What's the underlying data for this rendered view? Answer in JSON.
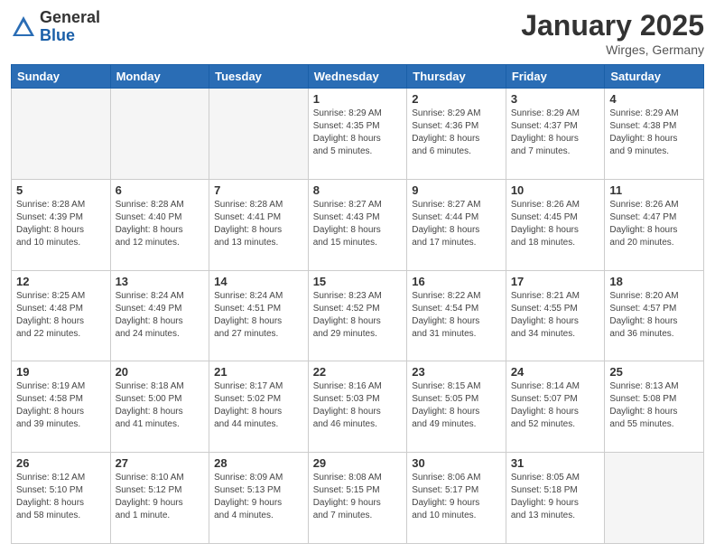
{
  "logo": {
    "general": "General",
    "blue": "Blue"
  },
  "header": {
    "month": "January 2025",
    "location": "Wirges, Germany"
  },
  "weekdays": [
    "Sunday",
    "Monday",
    "Tuesday",
    "Wednesday",
    "Thursday",
    "Friday",
    "Saturday"
  ],
  "weeks": [
    [
      {
        "day": "",
        "info": ""
      },
      {
        "day": "",
        "info": ""
      },
      {
        "day": "",
        "info": ""
      },
      {
        "day": "1",
        "info": "Sunrise: 8:29 AM\nSunset: 4:35 PM\nDaylight: 8 hours\nand 5 minutes."
      },
      {
        "day": "2",
        "info": "Sunrise: 8:29 AM\nSunset: 4:36 PM\nDaylight: 8 hours\nand 6 minutes."
      },
      {
        "day": "3",
        "info": "Sunrise: 8:29 AM\nSunset: 4:37 PM\nDaylight: 8 hours\nand 7 minutes."
      },
      {
        "day": "4",
        "info": "Sunrise: 8:29 AM\nSunset: 4:38 PM\nDaylight: 8 hours\nand 9 minutes."
      }
    ],
    [
      {
        "day": "5",
        "info": "Sunrise: 8:28 AM\nSunset: 4:39 PM\nDaylight: 8 hours\nand 10 minutes."
      },
      {
        "day": "6",
        "info": "Sunrise: 8:28 AM\nSunset: 4:40 PM\nDaylight: 8 hours\nand 12 minutes."
      },
      {
        "day": "7",
        "info": "Sunrise: 8:28 AM\nSunset: 4:41 PM\nDaylight: 8 hours\nand 13 minutes."
      },
      {
        "day": "8",
        "info": "Sunrise: 8:27 AM\nSunset: 4:43 PM\nDaylight: 8 hours\nand 15 minutes."
      },
      {
        "day": "9",
        "info": "Sunrise: 8:27 AM\nSunset: 4:44 PM\nDaylight: 8 hours\nand 17 minutes."
      },
      {
        "day": "10",
        "info": "Sunrise: 8:26 AM\nSunset: 4:45 PM\nDaylight: 8 hours\nand 18 minutes."
      },
      {
        "day": "11",
        "info": "Sunrise: 8:26 AM\nSunset: 4:47 PM\nDaylight: 8 hours\nand 20 minutes."
      }
    ],
    [
      {
        "day": "12",
        "info": "Sunrise: 8:25 AM\nSunset: 4:48 PM\nDaylight: 8 hours\nand 22 minutes."
      },
      {
        "day": "13",
        "info": "Sunrise: 8:24 AM\nSunset: 4:49 PM\nDaylight: 8 hours\nand 24 minutes."
      },
      {
        "day": "14",
        "info": "Sunrise: 8:24 AM\nSunset: 4:51 PM\nDaylight: 8 hours\nand 27 minutes."
      },
      {
        "day": "15",
        "info": "Sunrise: 8:23 AM\nSunset: 4:52 PM\nDaylight: 8 hours\nand 29 minutes."
      },
      {
        "day": "16",
        "info": "Sunrise: 8:22 AM\nSunset: 4:54 PM\nDaylight: 8 hours\nand 31 minutes."
      },
      {
        "day": "17",
        "info": "Sunrise: 8:21 AM\nSunset: 4:55 PM\nDaylight: 8 hours\nand 34 minutes."
      },
      {
        "day": "18",
        "info": "Sunrise: 8:20 AM\nSunset: 4:57 PM\nDaylight: 8 hours\nand 36 minutes."
      }
    ],
    [
      {
        "day": "19",
        "info": "Sunrise: 8:19 AM\nSunset: 4:58 PM\nDaylight: 8 hours\nand 39 minutes."
      },
      {
        "day": "20",
        "info": "Sunrise: 8:18 AM\nSunset: 5:00 PM\nDaylight: 8 hours\nand 41 minutes."
      },
      {
        "day": "21",
        "info": "Sunrise: 8:17 AM\nSunset: 5:02 PM\nDaylight: 8 hours\nand 44 minutes."
      },
      {
        "day": "22",
        "info": "Sunrise: 8:16 AM\nSunset: 5:03 PM\nDaylight: 8 hours\nand 46 minutes."
      },
      {
        "day": "23",
        "info": "Sunrise: 8:15 AM\nSunset: 5:05 PM\nDaylight: 8 hours\nand 49 minutes."
      },
      {
        "day": "24",
        "info": "Sunrise: 8:14 AM\nSunset: 5:07 PM\nDaylight: 8 hours\nand 52 minutes."
      },
      {
        "day": "25",
        "info": "Sunrise: 8:13 AM\nSunset: 5:08 PM\nDaylight: 8 hours\nand 55 minutes."
      }
    ],
    [
      {
        "day": "26",
        "info": "Sunrise: 8:12 AM\nSunset: 5:10 PM\nDaylight: 8 hours\nand 58 minutes."
      },
      {
        "day": "27",
        "info": "Sunrise: 8:10 AM\nSunset: 5:12 PM\nDaylight: 9 hours\nand 1 minute."
      },
      {
        "day": "28",
        "info": "Sunrise: 8:09 AM\nSunset: 5:13 PM\nDaylight: 9 hours\nand 4 minutes."
      },
      {
        "day": "29",
        "info": "Sunrise: 8:08 AM\nSunset: 5:15 PM\nDaylight: 9 hours\nand 7 minutes."
      },
      {
        "day": "30",
        "info": "Sunrise: 8:06 AM\nSunset: 5:17 PM\nDaylight: 9 hours\nand 10 minutes."
      },
      {
        "day": "31",
        "info": "Sunrise: 8:05 AM\nSunset: 5:18 PM\nDaylight: 9 hours\nand 13 minutes."
      },
      {
        "day": "",
        "info": ""
      }
    ]
  ]
}
